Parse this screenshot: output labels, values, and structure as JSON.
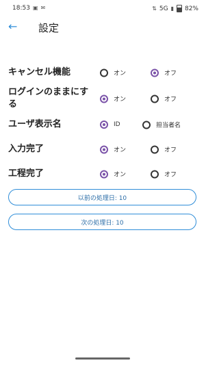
{
  "status_bar": {
    "time": "18:53",
    "network": "5G",
    "battery": "82%"
  },
  "header": {
    "title": "設定"
  },
  "settings": [
    {
      "label": "キャンセル機能",
      "options": [
        "オン",
        "オフ"
      ],
      "selected": 1
    },
    {
      "label": "ログインのままにする",
      "options": [
        "オン",
        "オフ"
      ],
      "selected": 0
    },
    {
      "label": "ユーザ表示名",
      "options": [
        "ID",
        "担当者名"
      ],
      "selected": 0
    },
    {
      "label": "入力完了",
      "options": [
        "オン",
        "オフ"
      ],
      "selected": 0
    },
    {
      "label": "工程完了",
      "options": [
        "オン",
        "オフ"
      ],
      "selected": 0
    }
  ],
  "buttons": {
    "previous": "以前の処理日: 10",
    "next": "次の処理日: 10"
  },
  "colors": {
    "accent": "#2e8dd8",
    "radio_selected": "#7a52a8"
  }
}
